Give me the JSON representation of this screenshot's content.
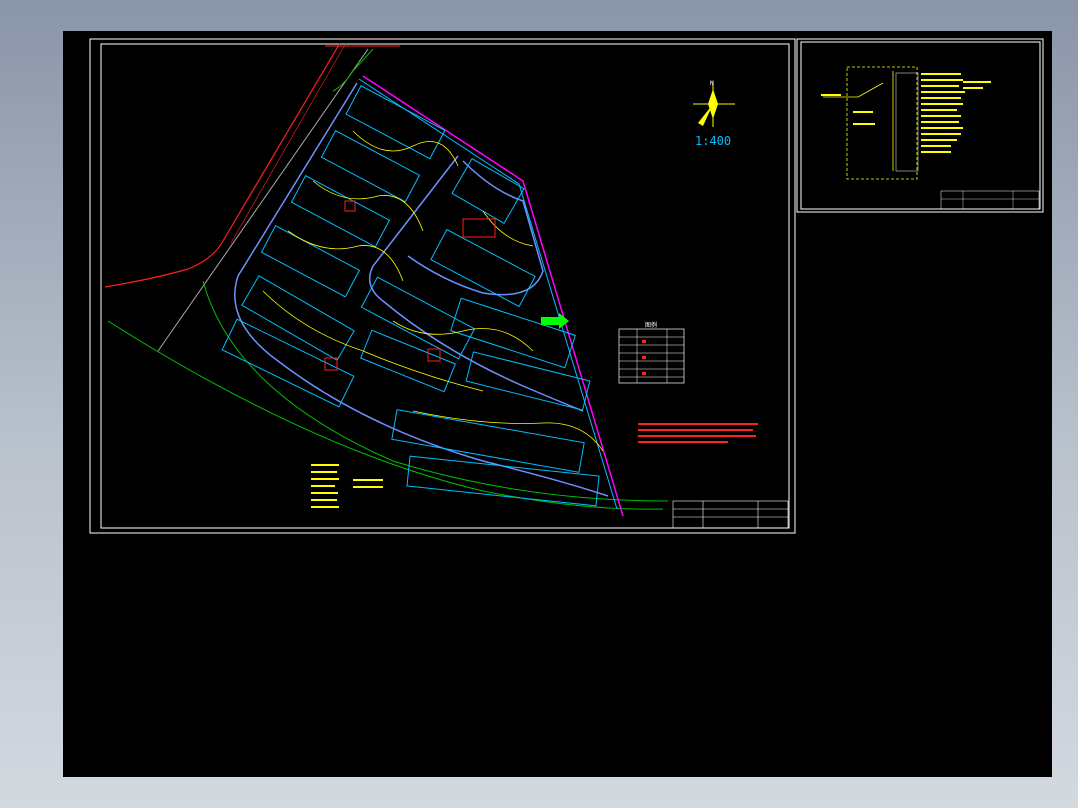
{
  "drawing": {
    "scale_label": "1:400",
    "north_label": "N",
    "legend_title": "图例",
    "colors": {
      "background": "#000000",
      "frame": "#ffffff",
      "boundary": "#ff00ff",
      "road_red": "#ff2020",
      "road_green": "#00c000",
      "building": "#00bfff",
      "network": "#ffff00",
      "annotation_red": "#ff2020",
      "annotation_yellow": "#ffff00",
      "north_arrow": "#ffff00",
      "scale_text": "#00bfff",
      "flow_arrow": "#00ff00"
    }
  },
  "viewport": {
    "name": "cad-model-space",
    "sheets": [
      "site-plan-sheet",
      "system-diagram-sheet"
    ]
  }
}
